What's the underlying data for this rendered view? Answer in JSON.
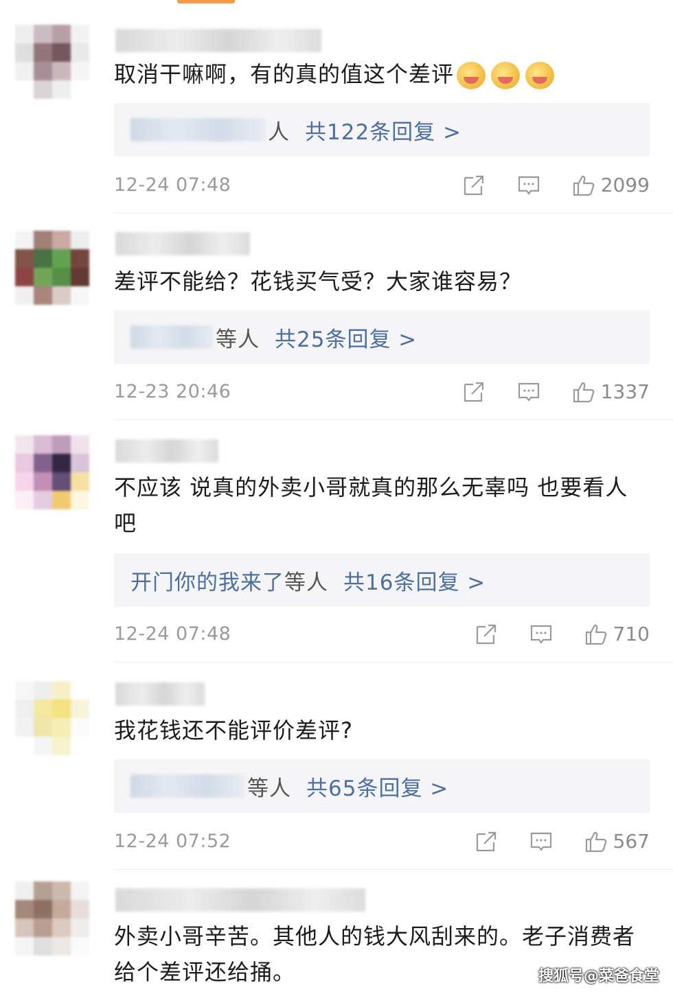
{
  "comments": [
    {
      "text": "取消干嘛啊，有的真的值这个差评",
      "emoji_count": 3,
      "reply_names": "",
      "reply_ren": "人",
      "reply_count": "共122条回复 >",
      "time": "12-24 07:48",
      "likes": "2099",
      "avatar_colors": [
        "#eee",
        "#c8b9bd",
        "#b49aa1",
        "#f2f2f2",
        "#ddd",
        "#8e6e76",
        "#6d5058",
        "#e8e8e8",
        "#f0f0f0",
        "#a48991",
        "#c9b5ba",
        "#f4f4f4",
        "#fff",
        "#d9d0d2",
        "#eee",
        "#fff"
      ]
    },
    {
      "text": "差评不能给？花钱买气受？大家谁容易？",
      "emoji_count": 0,
      "reply_names": "",
      "reply_ren": "等人",
      "reply_count": "共25条回复 >",
      "time": "12-23 20:46",
      "likes": "1337",
      "avatar_colors": [
        "#f4f4f4",
        "#9c7b6f",
        "#c7a59c",
        "#eee",
        "#7b4c3f",
        "#3f6b3a",
        "#58a048",
        "#6d3a33",
        "#8a3b3a",
        "#6aa250",
        "#4c8a3f",
        "#5a3029",
        "#efefef",
        "#a57f77",
        "#d8c9c5",
        "#f6f6f6"
      ]
    },
    {
      "text": "不应该  说真的外卖小哥就真的那么无辜吗  也要看人吧",
      "emoji_count": 0,
      "reply_names": "开门你的我来了",
      "reply_ren": "等人",
      "reply_count": "共16条回复 >",
      "time": "12-24 07:48",
      "likes": "710",
      "avatar_colors": [
        "#f3e4ee",
        "#d8b8d2",
        "#b998b9",
        "#f0e0ec",
        "#e8c6df",
        "#7b5a86",
        "#2a1c3a",
        "#d9c0d8",
        "#f6d2e8",
        "#c08ab3",
        "#5c4672",
        "#f5dfa0",
        "#fbeef6",
        "#e6c9e0",
        "#f2c86a",
        "#fff6e0"
      ]
    },
    {
      "text": "我花钱还不能评价差评?",
      "emoji_count": 0,
      "reply_names": "",
      "reply_ren": "等人",
      "reply_count": "共65条回复 >",
      "time": "12-24 07:52",
      "likes": "567",
      "avatar_colors": [
        "#f6f6f6",
        "#eeeeee",
        "#f7f0c4",
        "#ffffff",
        "#efefef",
        "#f4e79a",
        "#f2e27a",
        "#f7f3d8",
        "#f2f2f2",
        "#efe4a6",
        "#f6ecb0",
        "#fafafa",
        "#ffffff",
        "#f5f5f5",
        "#f7f1cc",
        "#ffffff"
      ]
    },
    {
      "text": "外卖小哥辛苦。其他人的钱大风刮来的。老子消费者给个差评还给捅。",
      "emoji_count": 0,
      "reply_names": "",
      "reply_ren": "",
      "reply_count": "",
      "time": "",
      "likes": "",
      "avatar_colors": [
        "#efefef",
        "#b29b8e",
        "#c9b6aa",
        "#f3f3f3",
        "#a08272",
        "#8a6a5a",
        "#c2a595",
        "#e5dcd6",
        "#d3c2b8",
        "#b7998a",
        "#d9c8be",
        "#f0ebe8",
        "#f4f4f4",
        "#ddd",
        "#ede6e2",
        "#fafafa"
      ]
    }
  ],
  "watermark": "搜狐号@菜爸食堂"
}
